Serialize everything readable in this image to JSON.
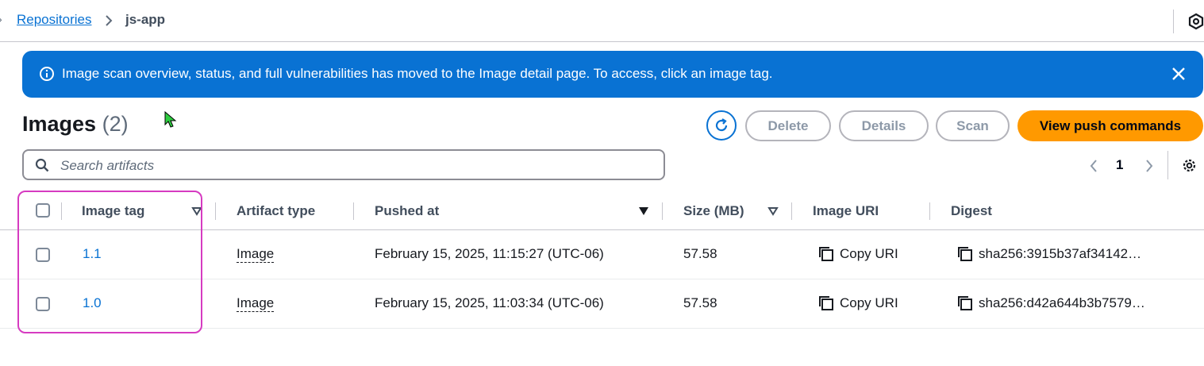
{
  "breadcrumb": {
    "parent": "Repositories",
    "current": "js-app"
  },
  "flash": {
    "message": "Image scan overview, status, and full vulnerabilities has moved to the Image detail page. To access, click an image tag.",
    "color": "#0972d3"
  },
  "header": {
    "title": "Images",
    "count": "(2)",
    "buttons": {
      "delete": "Delete",
      "details": "Details",
      "scan": "Scan",
      "push": "View push commands"
    }
  },
  "search": {
    "placeholder": "Search artifacts",
    "value": ""
  },
  "pagination": {
    "current_page": "1"
  },
  "table": {
    "columns": [
      "Image tag",
      "Artifact type",
      "Pushed at",
      "Size (MB)",
      "Image URI",
      "Digest"
    ],
    "rows": [
      {
        "tag": "1.1",
        "artifact_type": "Image",
        "pushed_at": "February 15, 2025, 11:15:27 (UTC-06)",
        "size": "57.58",
        "uri_action": "Copy URI",
        "digest": "sha256:3915b37af34142…"
      },
      {
        "tag": "1.0",
        "artifact_type": "Image",
        "pushed_at": "February 15, 2025, 11:03:34 (UTC-06)",
        "size": "57.58",
        "uri_action": "Copy URI",
        "digest": "sha256:d42a644b3b7579…"
      }
    ]
  },
  "colors": {
    "accent": "#0972d3",
    "primary_button": "#ff9900",
    "highlight": "#d63bc1"
  }
}
